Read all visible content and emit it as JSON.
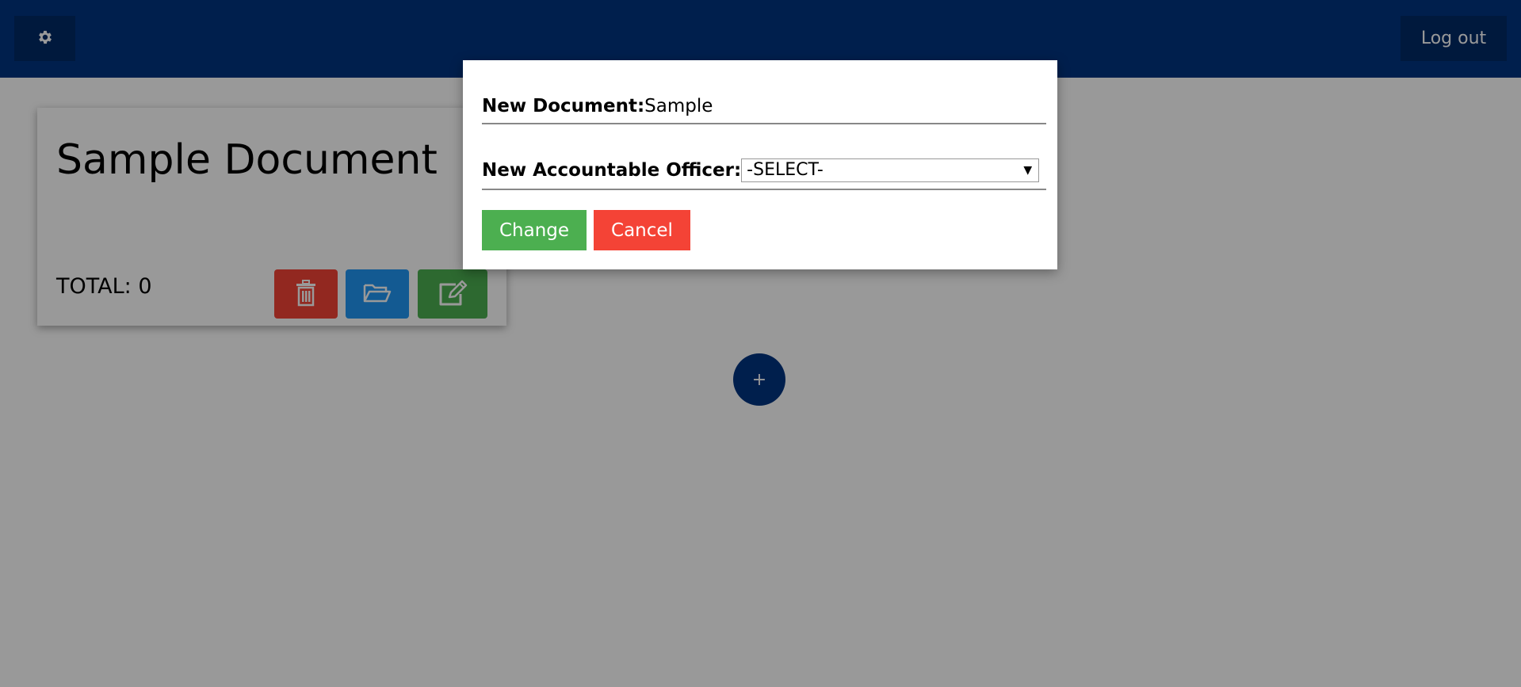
{
  "header": {
    "settings_icon": "gear-icon",
    "logout_label": "Log out",
    "background_color": "#003580"
  },
  "document_card": {
    "title": "Sample Document",
    "total_text": "TOTAL: 0",
    "actions": [
      {
        "icon": "trash-icon",
        "color": "#f44336"
      },
      {
        "icon": "folder-open-icon",
        "color": "#2196f3"
      },
      {
        "icon": "edit-icon",
        "color": "#4caf50"
      }
    ]
  },
  "fab": {
    "label": "+"
  },
  "modal": {
    "document_label": "New Document:",
    "document_value": "Sample",
    "officer_label": "New Accountable Officer:",
    "officer_select": {
      "selected": "-SELECT-",
      "arrow": "▼"
    },
    "change_label": "Change",
    "cancel_label": "Cancel",
    "colors": {
      "change": "#4caf50",
      "cancel": "#f44336"
    }
  }
}
